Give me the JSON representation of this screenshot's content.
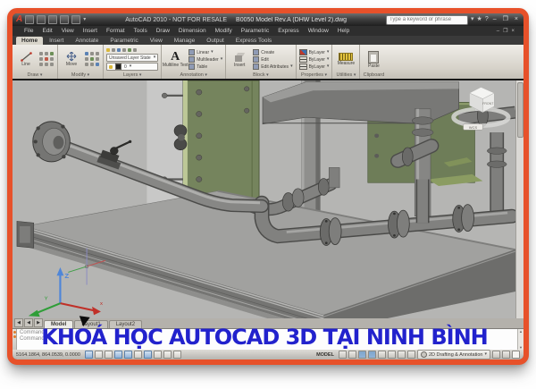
{
  "window": {
    "logo": "A",
    "title": "AutoCAD 2010 - NOT FOR RESALE",
    "document": "B0050 Model Rev.A (DHW Level 2).dwg",
    "search_placeholder": "Type a keyword or phrase",
    "controls": {
      "minimize": "–",
      "restore": "❐",
      "close": "×"
    }
  },
  "menubar": {
    "items": [
      "File",
      "Edit",
      "View",
      "Insert",
      "Format",
      "Tools",
      "Draw",
      "Dimension",
      "Modify",
      "Parametric",
      "Express",
      "Window",
      "Help"
    ]
  },
  "ribbon": {
    "tabs": [
      "Home",
      "Insert",
      "Annotate",
      "Parametric",
      "View",
      "Manage",
      "Output",
      "Express Tools"
    ],
    "panels": {
      "draw": {
        "label": "Draw",
        "tool": "Line"
      },
      "modify": {
        "label": "Modify",
        "tool": "Move"
      },
      "layers": {
        "label": "Layers",
        "state": "Unsaved Layer State",
        "current": "0"
      },
      "annotation": {
        "label": "Annotation",
        "tool": "Multiline Text",
        "items": [
          "Linear",
          "Multileader",
          "Table"
        ]
      },
      "block": {
        "label": "Block",
        "tool": "Insert",
        "items": [
          "Create",
          "Edit",
          "Edit Attributes"
        ]
      },
      "properties": {
        "label": "Properties",
        "bylayer": "ByLayer"
      },
      "utilities": {
        "label": "Utilities",
        "tool": "Measure"
      },
      "clipboard": {
        "label": "Clipboard",
        "tool": "Paste"
      }
    }
  },
  "viewport": {
    "viewcube": {
      "front": "FRONT",
      "menu": "WCS"
    },
    "ucs": {
      "x": "x",
      "y": "Y",
      "z": "Z"
    }
  },
  "layout_tabs": {
    "model": "Model",
    "layout1": "Layout1",
    "layout2": "Layout2"
  },
  "command_line": {
    "line1": "Command:",
    "line2": "Command:"
  },
  "statusbar": {
    "coordinates": "5164.1864, 864.0539, 0.0000",
    "model": "MODEL",
    "workspace": "2D Drafting & Annotation"
  },
  "banner": {
    "text": "KHOÁ HỌC AUTOCAD 3D TẠI NINH BÌNH",
    "color": "#2222cd"
  },
  "colors": {
    "frame": "#e7512a",
    "viewport_bg": "#b5b5b3",
    "hx_green": "#75845d"
  }
}
